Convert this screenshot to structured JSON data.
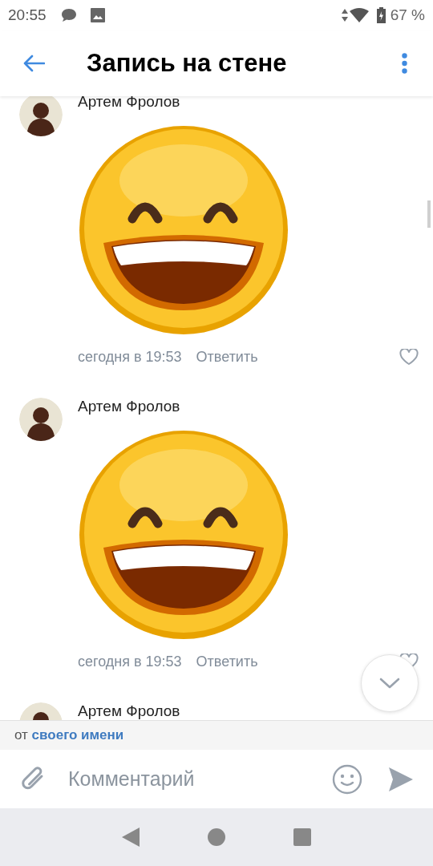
{
  "status_bar": {
    "time": "20:55",
    "battery": "67 %"
  },
  "header": {
    "title": "Запись на стене"
  },
  "comments": [
    {
      "author": "Артем Фролов",
      "kind": "sticker",
      "date": "сегодня в 19:53",
      "reply": "Ответить"
    },
    {
      "author": "Артем Фролов",
      "kind": "sticker",
      "date": "сегодня в 19:53",
      "reply": "Ответить"
    },
    {
      "author": "Артем Фролов"
    }
  ],
  "composer": {
    "sender_prefix": "от",
    "sender_name": "своего имени",
    "placeholder": "Комментарий"
  }
}
